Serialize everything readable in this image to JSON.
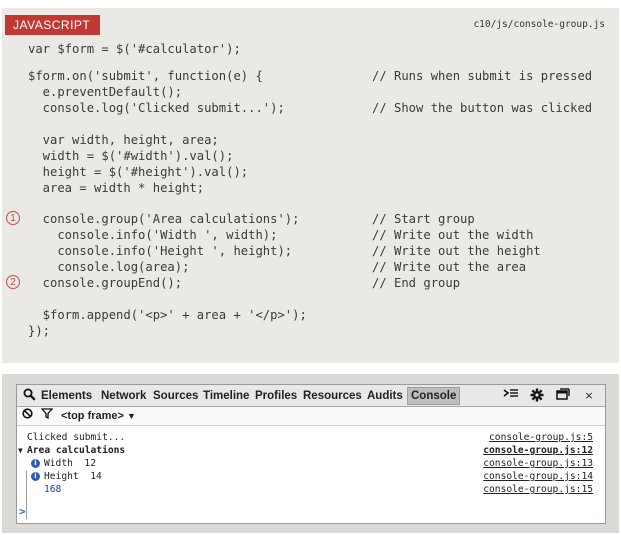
{
  "code_panel": {
    "language_badge": "JAVASCRIPT",
    "file_path": "c10/js/console-group.js",
    "lines": [
      {
        "code": "var $form = $('#calculator');",
        "comment": ""
      },
      {
        "code": "$form.on('submit', function(e) {",
        "comment": "// Runs when submit is pressed"
      },
      {
        "code": "  e.preventDefault();",
        "comment": ""
      },
      {
        "code": "  console.log('Clicked submit...');",
        "comment": "// Show the button was clicked"
      },
      {
        "code": "  var width, height, area;",
        "comment": ""
      },
      {
        "code": "  width = $('#width').val();",
        "comment": ""
      },
      {
        "code": "  height = $('#height').val();",
        "comment": ""
      },
      {
        "code": "  area = width * height;",
        "comment": ""
      },
      {
        "code": "  console.group('Area calculations');",
        "comment": "// Start group"
      },
      {
        "code": "    console.info('Width ', width);",
        "comment": "// Write out the width"
      },
      {
        "code": "    console.info('Height ', height);",
        "comment": "// Write out the height"
      },
      {
        "code": "    console.log(area);",
        "comment": "// Write out the area"
      },
      {
        "code": "  console.groupEnd();",
        "comment": "// End group"
      },
      {
        "code": "  $form.append('<p>' + area + '</p>');",
        "comment": ""
      },
      {
        "code": "});",
        "comment": ""
      }
    ],
    "markers": [
      "1",
      "2"
    ]
  },
  "devtools": {
    "tabs": [
      "Elements",
      "Network",
      "Sources",
      "Timeline",
      "Profiles",
      "Resources",
      "Audits",
      "Console"
    ],
    "active_tab": "Console",
    "frame_selector": "<top frame>",
    "icons": {
      "search": "search-icon",
      "clear": "clear-console-icon",
      "filter": "filter-icon",
      "frame_dropdown": "chevron-down-icon",
      "execute": "execute-icon",
      "settings": "gear-icon",
      "dock": "dock-icon",
      "close": "close-icon",
      "prompt": "prompt-icon"
    },
    "log": [
      {
        "message": "Clicked submit...",
        "source": "console-group.js:5"
      },
      {
        "message": "Area calculations",
        "source": "console-group.js:12"
      },
      {
        "message": "Width  12",
        "source": "console-group.js:13"
      },
      {
        "message": "Height  14",
        "source": "console-group.js:14"
      },
      {
        "message": "168",
        "source": "console-group.js:15"
      }
    ],
    "prompt_symbol": ">"
  },
  "colors": {
    "badge": "#c03a33",
    "code_background": "#ebe9e6",
    "marker": "#c0504a",
    "info_icon": "#2b5fb8",
    "number_value": "#1a3fa8"
  }
}
